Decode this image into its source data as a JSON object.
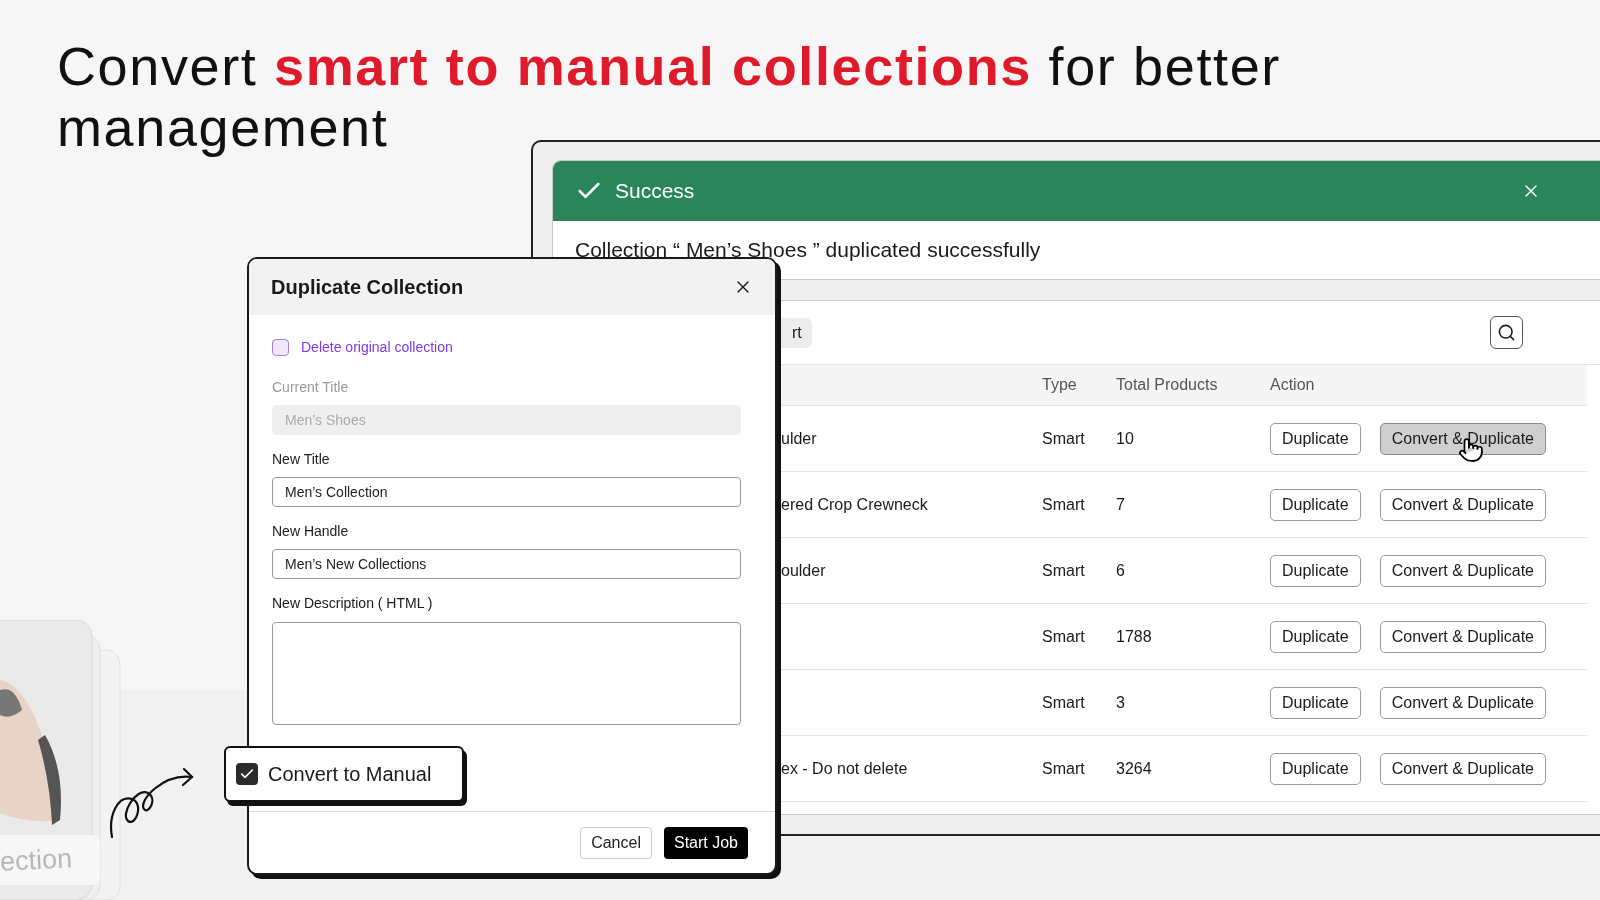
{
  "headline": "Convert **smart to manual collections** for better management",
  "success_toast": {
    "title": "Success",
    "message": "Collection “ Men’s Shoes ” duplicated successfully"
  },
  "toolbar": {
    "tab_fragment": "rt"
  },
  "table": {
    "columns": [
      "Type",
      "Total Products",
      "Action"
    ],
    "rows": [
      {
        "name": "ulder",
        "type": "Smart",
        "total": "10",
        "actions": [
          {
            "label": "Duplicate",
            "hovered": false
          },
          {
            "label": "Convert & Duplicate",
            "hovered": true
          }
        ]
      },
      {
        "name": "ered Crop Crewneck",
        "type": "Smart",
        "total": "7",
        "actions": [
          {
            "label": "Duplicate",
            "hovered": false
          },
          {
            "label": "Convert & Duplicate",
            "hovered": false
          }
        ]
      },
      {
        "name": "oulder",
        "type": "Smart",
        "total": "6",
        "actions": [
          {
            "label": "Duplicate",
            "hovered": false
          },
          {
            "label": "Convert & Duplicate",
            "hovered": false
          }
        ]
      },
      {
        "name": "",
        "type": "Smart",
        "total": "1788",
        "actions": [
          {
            "label": "Duplicate",
            "hovered": false
          },
          {
            "label": "Convert & Duplicate",
            "hovered": false
          }
        ]
      },
      {
        "name": "",
        "type": "Smart",
        "total": "3",
        "actions": [
          {
            "label": "Duplicate",
            "hovered": false
          },
          {
            "label": "Convert & Duplicate",
            "hovered": false
          }
        ]
      },
      {
        "name": "ex - Do not delete",
        "type": "Smart",
        "total": "3264",
        "actions": [
          {
            "label": "Duplicate",
            "hovered": false
          },
          {
            "label": "Convert & Duplicate",
            "hovered": false
          }
        ]
      }
    ]
  },
  "dialog": {
    "title": "Duplicate Collection",
    "delete_original": {
      "label": "Delete original collection",
      "checked": false
    },
    "fields": [
      {
        "label": "Current Title",
        "value": "Men’s Shoes",
        "disabled": true
      },
      {
        "label": "New Title",
        "value": "Men’s Collection",
        "disabled": false
      },
      {
        "label": "New Handle",
        "value": "Men’s New Collections",
        "disabled": false
      }
    ],
    "description": {
      "label": "New Description ( HTML )"
    },
    "buttons": [
      {
        "label": "Cancel",
        "kind": "secondary"
      },
      {
        "label": "Start Job",
        "kind": "primary"
      }
    ]
  },
  "callout": {
    "label": "Convert to Manual",
    "checked": true
  },
  "product_card": {
    "kind": "picture",
    "label": "ection"
  }
}
